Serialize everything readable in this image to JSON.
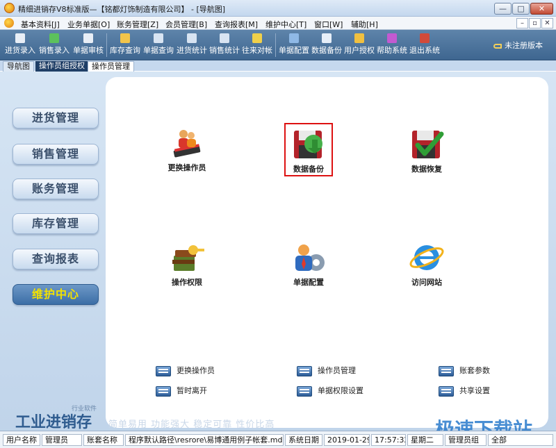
{
  "window": {
    "title": "精细进销存V8标准版—【铭都灯饰制造有限公司】 - [导航图]",
    "min": "—",
    "max": "□",
    "close": "✕"
  },
  "menu": {
    "items": [
      "基本资料[J]",
      "业务单据[O]",
      "账务管理[Z]",
      "会员管理[B]",
      "查询报表[M]",
      "维护中心[T]",
      "窗口[W]",
      "辅助[H]"
    ],
    "mdi": [
      "–",
      "▫",
      "✕"
    ]
  },
  "toolbar": {
    "buttons": [
      {
        "label": "进货录入",
        "icon": "purchase-entry-icon",
        "color": "#e8eef6"
      },
      {
        "label": "销售录入",
        "icon": "sales-entry-icon",
        "color": "#5cc15c"
      },
      {
        "label": "单据审核",
        "icon": "document-audit-icon",
        "color": "#e8eef6"
      },
      {
        "label": "库存查询",
        "icon": "inventory-query-icon",
        "color": "#f2c54a"
      },
      {
        "label": "单据查询",
        "icon": "document-query-icon",
        "color": "#d8e4f2"
      },
      {
        "label": "进货统计",
        "icon": "purchase-stats-icon",
        "color": "#d8e4f2"
      },
      {
        "label": "销售统计",
        "icon": "sales-stats-icon",
        "color": "#d8e4f2"
      },
      {
        "label": "往来对帐",
        "icon": "reconcile-icon",
        "color": "#f0d04a"
      },
      {
        "label": "单据配置",
        "icon": "document-config-icon",
        "color": "#8fb9e6"
      },
      {
        "label": "数据备份",
        "icon": "data-backup-icon",
        "color": "#e6eef8"
      },
      {
        "label": "用户授权",
        "icon": "user-auth-icon",
        "color": "#f0c040"
      },
      {
        "label": "帮助系统",
        "icon": "help-system-icon",
        "color": "#c35ad1"
      },
      {
        "label": "退出系统",
        "icon": "exit-system-icon",
        "color": "#d14a3a"
      }
    ],
    "registration": "未注册版本"
  },
  "tabs": [
    "导航图",
    "操作员组授权",
    "操作员管理"
  ],
  "sidebar": {
    "items": [
      "进货管理",
      "销售管理",
      "账务管理",
      "库存管理",
      "查询报表",
      "维护中心"
    ],
    "active_index": 5
  },
  "functions": [
    {
      "label": "更换操作员",
      "icon": "change-operator-icon"
    },
    {
      "label": "数据备份",
      "icon": "data-backup-icon"
    },
    {
      "label": "数据恢复",
      "icon": "data-restore-icon"
    },
    {
      "label": "操作权限",
      "icon": "permissions-icon"
    },
    {
      "label": "单据配置",
      "icon": "document-config-icon"
    },
    {
      "label": "访问网站",
      "icon": "visit-website-icon"
    }
  ],
  "links": [
    "更换操作员",
    "操作员管理",
    "账套参数",
    "暂时离开",
    "单据权限设置",
    "共享设置"
  ],
  "branding": {
    "name": "工业进销存",
    "sub": "行业软件",
    "slogan": "简单易用 功能强大 稳定可靠 性价比高",
    "watermark": "极速下载站"
  },
  "statusbar": {
    "user_label": "用户名称",
    "user_value": "管理员",
    "account_label": "账套名称",
    "account_path": "程序默认路径\\resrore\\易博通用例子帐套.mdb",
    "date_label": "系统日期",
    "date_value": "2019-01-29",
    "time_value": "17:57:32",
    "weekday": "星期二",
    "role": "管理员组",
    "scope": "全部"
  }
}
